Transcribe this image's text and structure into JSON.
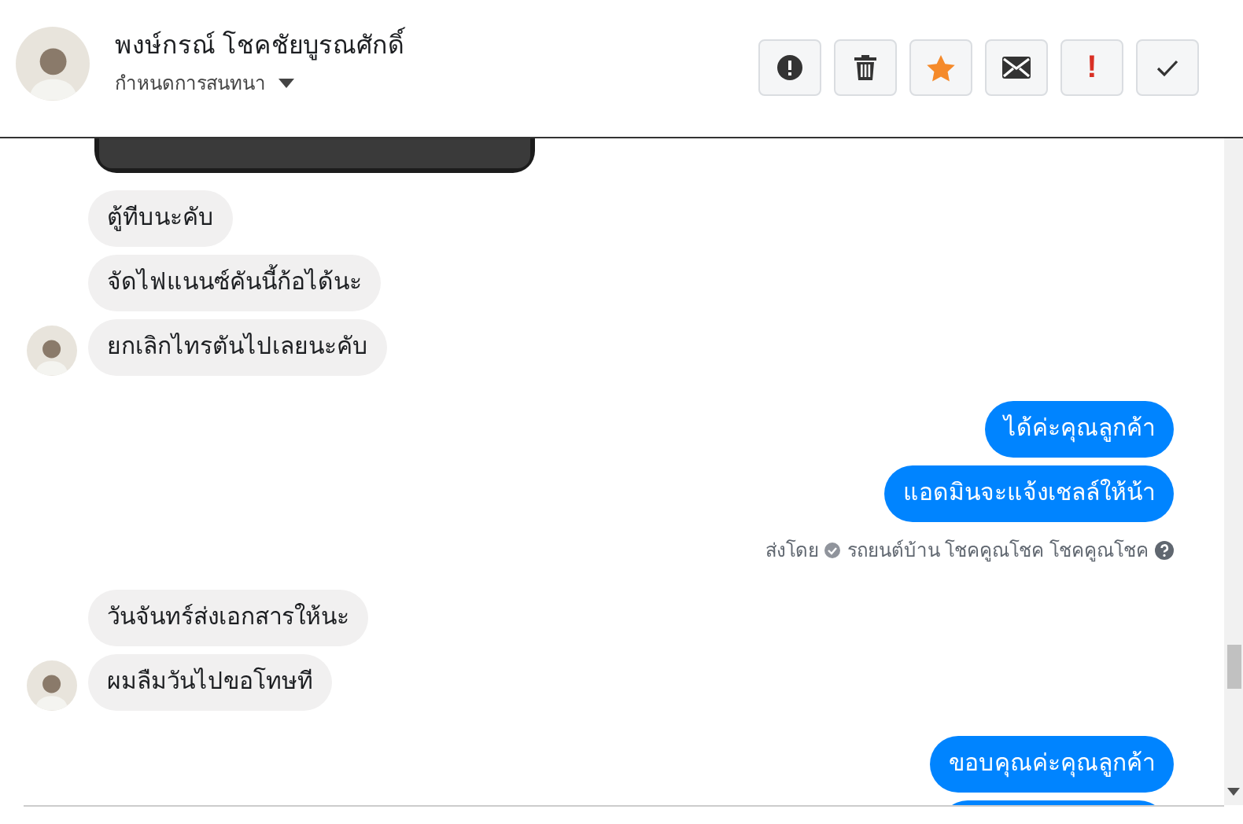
{
  "header": {
    "name": "พงษ์กรณ์ โชคชัยบูรณศักดิ์",
    "subtitle": "กำหนดการสนทนา",
    "actions": [
      {
        "kind": "alert"
      },
      {
        "kind": "trash"
      },
      {
        "kind": "star"
      },
      {
        "kind": "mail"
      },
      {
        "kind": "mark",
        "text": "!"
      },
      {
        "kind": "check"
      }
    ]
  },
  "messages": [
    {
      "kind": "photo"
    },
    {
      "kind": "incoming",
      "text": "ตู้ทีบนะคับ",
      "avatar": false
    },
    {
      "kind": "incoming",
      "text": "จัดไฟแนนซ์คันนี้ก้อได้นะ",
      "avatar": false
    },
    {
      "kind": "incoming",
      "text": "ยกเลิกไทรตันไปเลยนะคับ",
      "avatar": true
    },
    {
      "kind": "outgoing",
      "text": "ได้ค่ะคุณลูกค้า"
    },
    {
      "kind": "outgoing",
      "text": "แอดมินจะแจ้งเชลล์ให้น้า"
    },
    {
      "kind": "sender",
      "prefix": "ส่งโดย",
      "name": "รถยนต์บ้าน โชคคูณโชค โชคคูณโชค"
    },
    {
      "kind": "incoming",
      "text": "วันจันทร์ส่งเอกสารให้นะ",
      "avatar": false
    },
    {
      "kind": "incoming",
      "text": "ผมลืมวันไปขอโทษที",
      "avatar": true
    },
    {
      "kind": "outgoing",
      "text": "ขอบคุณค่ะคุณลูกค้า"
    },
    {
      "kind": "partial"
    }
  ]
}
